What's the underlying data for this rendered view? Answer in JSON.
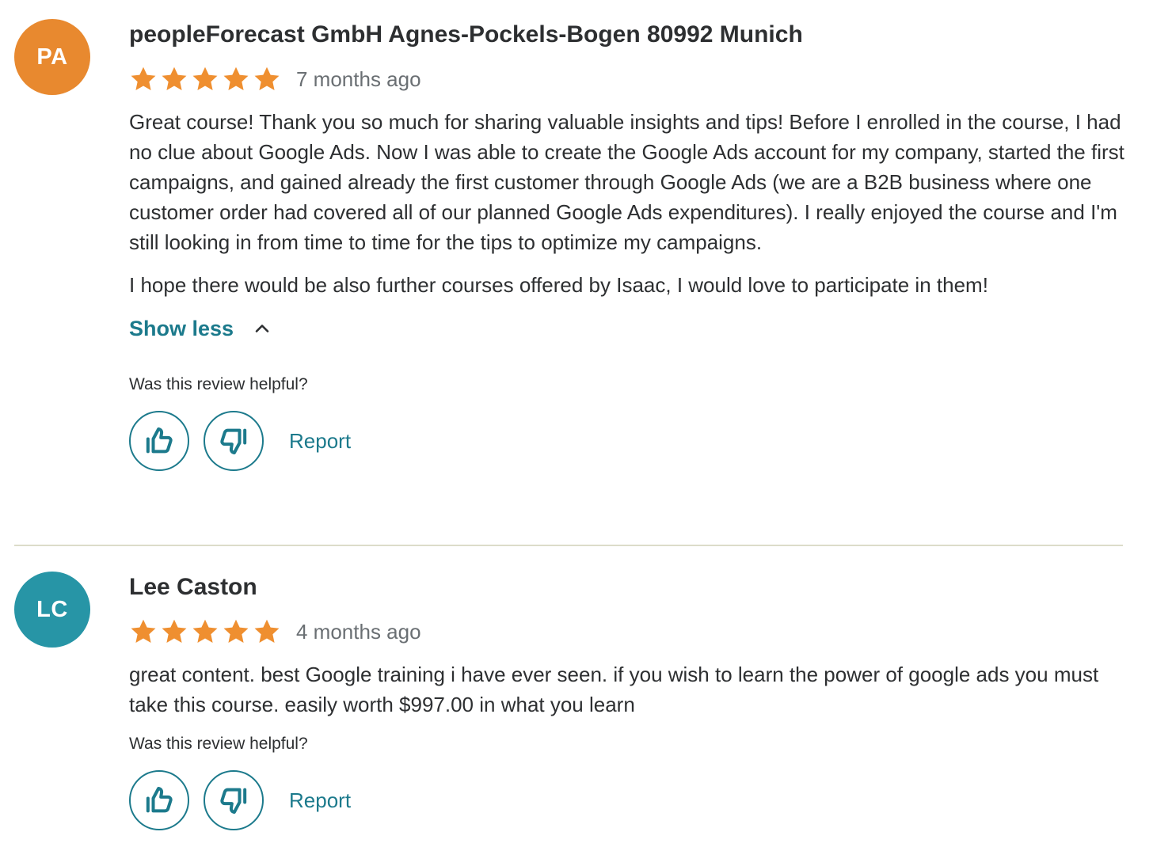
{
  "reviews": [
    {
      "initials": "PA",
      "avatar_color": "#e8892f",
      "name": "peopleForecast GmbH Agnes-Pockels-Bogen 80992 Munich",
      "rating": 5,
      "time": "7 months ago",
      "paragraphs": [
        "Great course! Thank you so much for sharing valuable insights and tips! Before I enrolled in the course, I had no clue about Google Ads. Now I was able to create the Google Ads account for my company, started the first campaigns, and gained already the first customer through Google Ads (we are a B2B business where one customer order had covered all of our planned Google Ads expenditures). I really enjoyed the course and I'm still looking in from time to time for the tips to optimize my campaigns.",
        "I hope there would be also further courses offered by Isaac, I would love to participate in them!"
      ],
      "show_less_label": "Show less",
      "helpful_question": "Was this review helpful?",
      "report_label": "Report"
    },
    {
      "initials": "LC",
      "avatar_color": "#2795a6",
      "name": "Lee Caston",
      "rating": 5,
      "time": "4 months ago",
      "paragraphs": [
        "great content. best Google training i have ever seen. if you wish to learn the power of google ads you must take this course. easily worth $997.00 in what you learn"
      ],
      "helpful_question": "Was this review helpful?",
      "report_label": "Report"
    }
  ],
  "colors": {
    "accent": "#1c7a8c",
    "star": "#ef8f30",
    "divider": "#dcdcc9"
  },
  "icons": {
    "star": "star-icon",
    "thumbs_up": "thumbs-up-icon",
    "thumbs_down": "thumbs-down-icon",
    "chevron": "chevron-up-icon"
  }
}
